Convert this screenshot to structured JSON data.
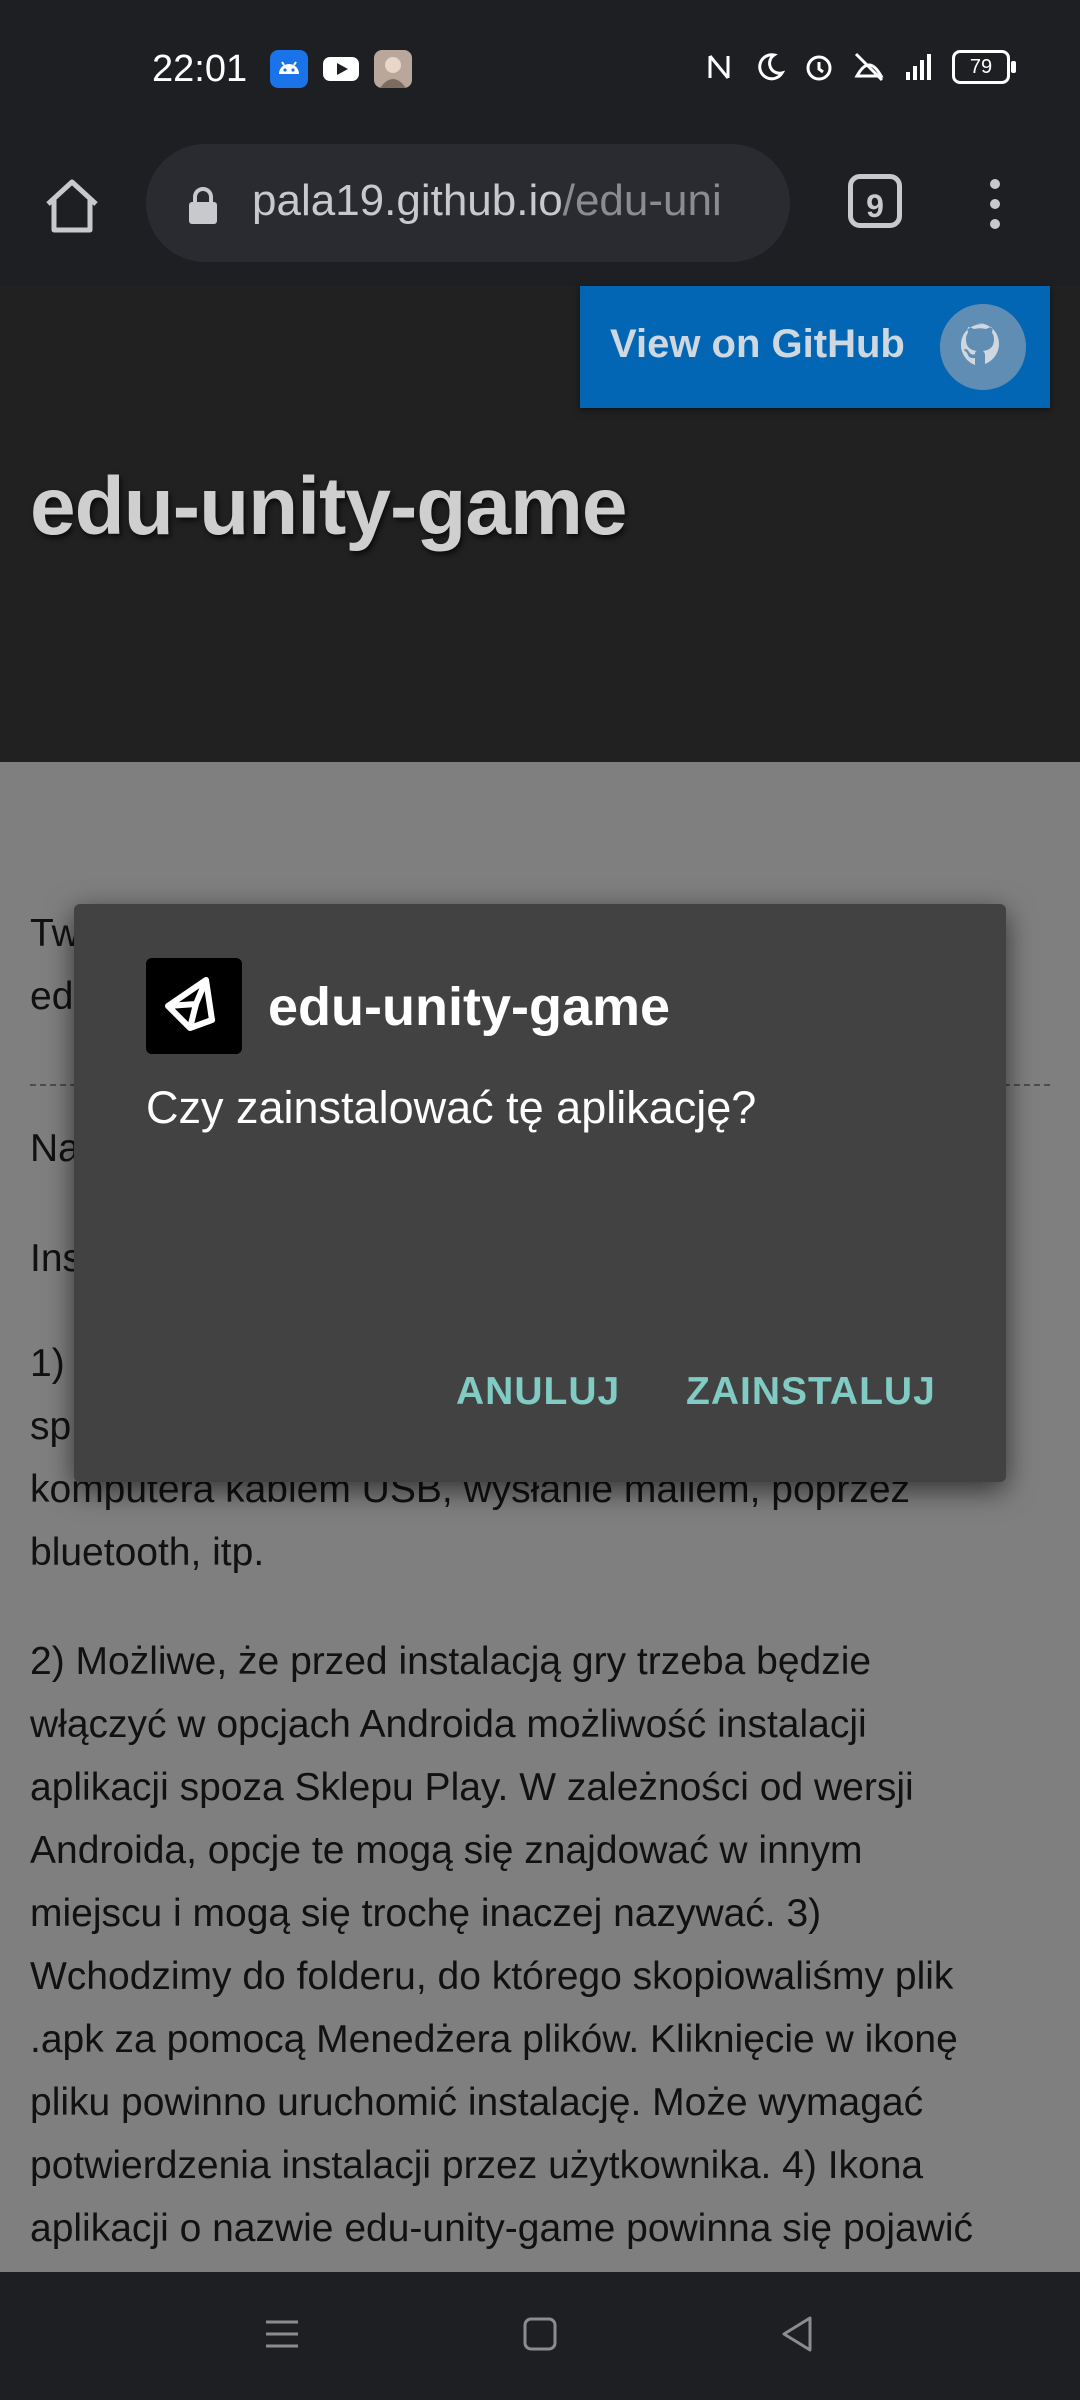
{
  "status_bar": {
    "time": "22:01",
    "left_icons": [
      "android-app-icon",
      "youtube-icon",
      "avatar-app-icon"
    ],
    "right_icons": [
      "nfc-icon",
      "moon-icon",
      "alarm-icon",
      "vibrate-icon",
      "signal-lte-icon"
    ],
    "battery": "79"
  },
  "browser": {
    "url_main": "pala19.github.io",
    "url_rest": "/edu-uni",
    "tab_count": "9"
  },
  "page": {
    "github_button": "View on GitHub",
    "title": "edu-unity-game",
    "para_top_1": "Tw",
    "para_top_2": "ed",
    "para_na": "Na",
    "para_ins": "Ins",
    "para_1a": "1)",
    "para_1b": "sp",
    "para_1c": "komputera kablem USB, wysłanie mailem, poprzez",
    "para_1d": "bluetooth, itp.",
    "para_2a": "2) Możliwe, że przed instalacją gry trzeba będzie",
    "para_2b": "włączyć w opcjach Androida możliwość instalacji",
    "para_2c": "aplikacji spoza Sklepu Play. W zależności od wersji",
    "para_2d": "Androida, opcje te mogą się znajdować w innym",
    "para_2e": "miejscu i mogą się trochę inaczej nazywać. 3)",
    "para_2f": "Wchodzimy do folderu, do którego skopiowaliśmy plik",
    "para_2g": ".apk za pomocą Menedżera plików. Kliknięcie w ikonę",
    "para_2h": "pliku powinno uruchomić instalację. Może wymagać",
    "para_2i": "potwierdzenia instalacji przez użytkownika. 4) Ikona",
    "para_2j": "aplikacji o nazwie edu-unity-game powinna się pojawić"
  },
  "dialog": {
    "app_name": "edu-unity-game",
    "message": "Czy zainstalować tę aplikację?",
    "cancel": "ANULUJ",
    "install": "ZAINSTALUJ"
  },
  "colors": {
    "accent_button": "#80cbc4",
    "github_blue": "#0366b4",
    "dialog_bg": "#424242"
  }
}
